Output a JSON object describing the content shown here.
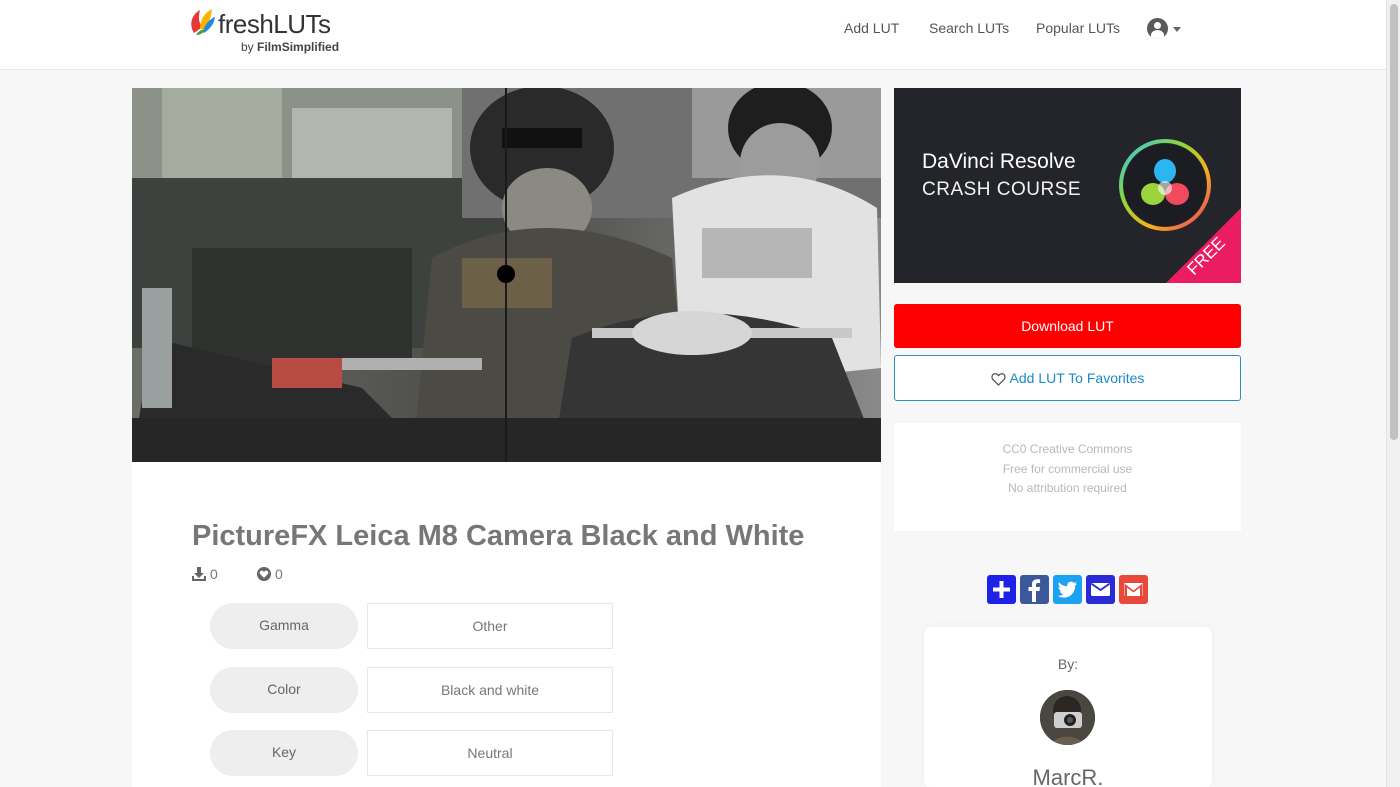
{
  "brand": {
    "name": "freshLUTs",
    "sub_prefix": "by",
    "sub_name": "FilmSimplified"
  },
  "nav": {
    "add": "Add LUT",
    "search": "Search LUTs",
    "popular": "Popular LUTs"
  },
  "lut": {
    "title": "PictureFX Leica M8 Camera Black and White",
    "downloads": "0",
    "favorites": "0",
    "properties": [
      {
        "label": "Gamma",
        "value": "Other"
      },
      {
        "label": "Color",
        "value": "Black and white"
      },
      {
        "label": "Key",
        "value": "Neutral"
      }
    ]
  },
  "ad": {
    "title": "DaVinci Resolve",
    "subtitle": "CRASH COURSE",
    "ribbon": "FREE"
  },
  "actions": {
    "download": "Download LUT",
    "favorite": "Add LUT To Favorites"
  },
  "license": {
    "line1": "CC0 Creative Commons",
    "line2": "Free for commercial use",
    "line3": "No attribution required"
  },
  "share": [
    "share-plus-icon",
    "facebook-icon",
    "twitter-icon",
    "email-icon",
    "gmail-icon"
  ],
  "author": {
    "by": "By:",
    "name": "MarcR."
  },
  "colors": {
    "download": "#ff0000",
    "favorite_border": "#2a8fbd",
    "ad_bg": "#24252a",
    "share_plus": "#1e22e8",
    "facebook": "#3b5998",
    "twitter": "#1da1f2",
    "email": "#2b2bd6",
    "gmail": "#e8493a"
  }
}
